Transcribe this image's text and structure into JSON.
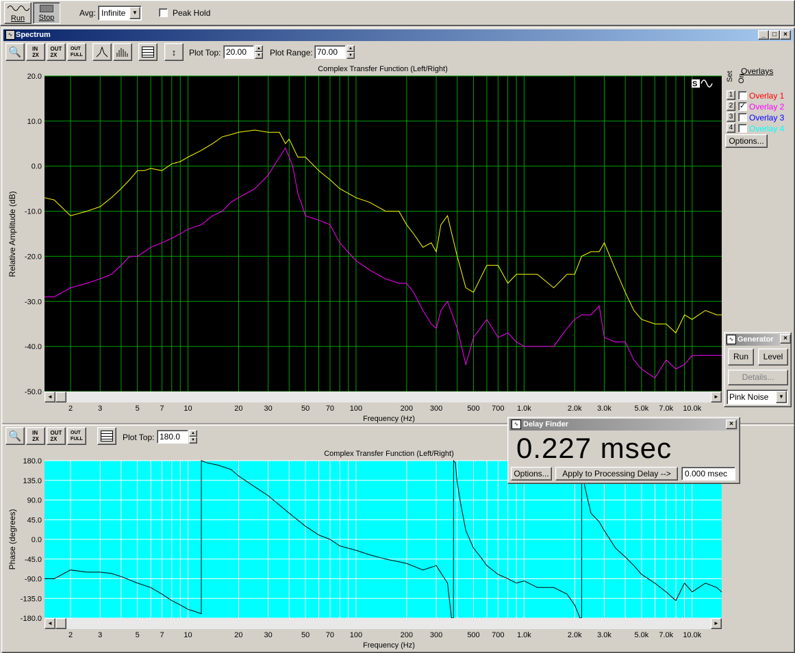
{
  "toolbar": {
    "run_label": "Run",
    "stop_label": "Stop",
    "avg_label": "Avg:",
    "avg_value": "Infinite",
    "peak_hold_label": "Peak Hold"
  },
  "spectrum_window": {
    "title": "Spectrum",
    "plot_top_label": "Plot Top:",
    "plot_top_value": "20.00",
    "plot_range_label": "Plot Range:",
    "plot_range_value": "70.00"
  },
  "phase_toolbar": {
    "plot_top_label": "Plot Top:",
    "plot_top_value": "180.0"
  },
  "overlays": {
    "header": "Overlays",
    "set_label": "Set",
    "on_label": "On",
    "items": [
      {
        "num": "1",
        "label": "Overlay 1",
        "color": "#ff0000",
        "checked": false
      },
      {
        "num": "2",
        "label": "Overlay 2",
        "color": "#ff00ff",
        "checked": true
      },
      {
        "num": "3",
        "label": "Overlay 3",
        "color": "#0000ff",
        "checked": false
      },
      {
        "num": "4",
        "label": "Overlay 4",
        "color": "#00ffff",
        "checked": false
      }
    ],
    "options_label": "Options..."
  },
  "generator": {
    "title": "Generator",
    "run_label": "Run",
    "level_label": "Level",
    "details_label": "Details...",
    "signal_value": "Pink Noise"
  },
  "delay_finder": {
    "title": "Delay Finder",
    "readout": "0.227 msec",
    "options_label": "Options...",
    "apply_label": "Apply to Processing Delay -->",
    "delay_value": "0.000 msec"
  },
  "chart_data": [
    {
      "type": "line",
      "title": "Complex Transfer Function (Left/Right)",
      "xlabel": "Frequency (Hz)",
      "ylabel": "Relative Amplitude (dB)",
      "x_scale": "log",
      "xlim": [
        1.4,
        15000
      ],
      "ylim": [
        -50,
        20
      ],
      "y_ticks": [
        "20.0",
        "10.0",
        "0.0",
        "-10.0",
        "-20.0",
        "-30.0",
        "-40.0",
        "-50.0"
      ],
      "x_ticks": [
        {
          "v": 2,
          "t": "2"
        },
        {
          "v": 3,
          "t": "3"
        },
        {
          "v": 5,
          "t": "5"
        },
        {
          "v": 7,
          "t": "7"
        },
        {
          "v": 10,
          "t": "10"
        },
        {
          "v": 20,
          "t": "20"
        },
        {
          "v": 30,
          "t": "30"
        },
        {
          "v": 50,
          "t": "50"
        },
        {
          "v": 70,
          "t": "70"
        },
        {
          "v": 100,
          "t": "100"
        },
        {
          "v": 200,
          "t": "200"
        },
        {
          "v": 300,
          "t": "300"
        },
        {
          "v": 500,
          "t": "500"
        },
        {
          "v": 700,
          "t": "700"
        },
        {
          "v": 1000,
          "t": "1.0k"
        },
        {
          "v": 2000,
          "t": "2.0k"
        },
        {
          "v": 3000,
          "t": "3.0k"
        },
        {
          "v": 5000,
          "t": "5.0k"
        },
        {
          "v": 7000,
          "t": "7.0k"
        },
        {
          "v": 10000,
          "t": "10.0k"
        }
      ],
      "background": "#000000",
      "grid": true,
      "grid_color": "#00a000",
      "series": [
        {
          "color": "#ffff00",
          "x": [
            1.4,
            1.6,
            2,
            2.5,
            3,
            3.5,
            4,
            4.5,
            5,
            5.5,
            6,
            7,
            8,
            9,
            10,
            12,
            14,
            16,
            18,
            20,
            25,
            30,
            35,
            38,
            40,
            45,
            50,
            60,
            70,
            80,
            100,
            120,
            150,
            180,
            200,
            220,
            250,
            280,
            300,
            320,
            350,
            400,
            450,
            500,
            600,
            700,
            800,
            900,
            1000,
            1200,
            1500,
            1800,
            2000,
            2200,
            2500,
            2800,
            3000,
            3500,
            4000,
            4500,
            5000,
            6000,
            7000,
            8000,
            9000,
            10000,
            12000,
            14000,
            15000
          ],
          "y": [
            -7,
            -7.5,
            -11,
            -10,
            -9,
            -7,
            -5,
            -3,
            -1,
            -1,
            -0.5,
            -1,
            0.5,
            1,
            2,
            3.5,
            5,
            6.5,
            7,
            7.5,
            8,
            7.5,
            7.5,
            5,
            6,
            2,
            2,
            -1,
            -3,
            -5,
            -7,
            -8,
            -10,
            -10,
            -13,
            -15,
            -18,
            -17,
            -19,
            -13,
            -11,
            -20,
            -27,
            -28,
            -22,
            -22,
            -26,
            -24,
            -24,
            -24,
            -27,
            -24,
            -24,
            -20,
            -19,
            -19,
            -17,
            -23,
            -28,
            -32,
            -34,
            -35,
            -35,
            -37,
            -33,
            -34,
            -32,
            -33,
            -33
          ]
        },
        {
          "color": "#ff00ff",
          "x": [
            1.4,
            1.6,
            2,
            2.5,
            3,
            3.5,
            4,
            4.5,
            5,
            5.5,
            6,
            7,
            8,
            9,
            10,
            12,
            14,
            16,
            18,
            20,
            25,
            30,
            35,
            38,
            40,
            42,
            45,
            50,
            60,
            70,
            80,
            100,
            120,
            150,
            180,
            200,
            220,
            250,
            280,
            300,
            320,
            350,
            400,
            450,
            500,
            600,
            700,
            800,
            900,
            1000,
            1200,
            1500,
            1800,
            2000,
            2200,
            2500,
            2800,
            3000,
            3500,
            4000,
            4500,
            5000,
            6000,
            7000,
            8000,
            9000,
            10000,
            12000,
            14000,
            15000
          ],
          "y": [
            -29,
            -29,
            -27,
            -26,
            -25,
            -24,
            -22,
            -20,
            -20,
            -19,
            -18,
            -17,
            -16,
            -15,
            -14,
            -13,
            -11,
            -10,
            -8,
            -7,
            -5,
            -2,
            2,
            4,
            2,
            0,
            -6,
            -11,
            -12,
            -13,
            -17,
            -21,
            -23,
            -25,
            -26,
            -26,
            -28,
            -32,
            -35,
            -36,
            -32,
            -30,
            -36,
            -44,
            -38,
            -34,
            -38,
            -37,
            -39,
            -40,
            -40,
            -40,
            -36,
            -34,
            -33,
            -33,
            -31,
            -38,
            -39,
            -39,
            -43,
            -45,
            -47,
            -43,
            -45,
            -44,
            -42,
            -42,
            -42,
            -42
          ]
        }
      ]
    },
    {
      "type": "line",
      "title": "Complex Transfer Function (Left/Right)",
      "xlabel": "Frequency (Hz)",
      "ylabel": "Phase (degrees)",
      "x_scale": "log",
      "xlim": [
        1.4,
        15000
      ],
      "ylim": [
        -180,
        180
      ],
      "y_ticks": [
        "180.0",
        "135.0",
        "90.0",
        "45.0",
        "0.0",
        "-45.0",
        "-90.0",
        "-135.0",
        "-180.0"
      ],
      "background": "#00ffff",
      "grid": true,
      "grid_color": "#ffffff",
      "series": [
        {
          "color": "#000000",
          "x": [
            1.4,
            1.6,
            2,
            2.5,
            3,
            3.5,
            4,
            5,
            6,
            7,
            8,
            9,
            10,
            11,
            12,
            12.01,
            13,
            15,
            18,
            20,
            25,
            30,
            40,
            50,
            60,
            70,
            80,
            100,
            120,
            150,
            200,
            250,
            300,
            350,
            370,
            380,
            380.5,
            390,
            400,
            420,
            450,
            500,
            550,
            600,
            700,
            800,
            900,
            1000,
            1200,
            1500,
            1800,
            2000,
            2100,
            2150,
            2200,
            2200.5,
            2300,
            2500,
            2800,
            3000,
            3500,
            4000,
            4500,
            5000,
            6000,
            7000,
            8000,
            9000,
            10000,
            12000,
            14000,
            15000
          ],
          "y": [
            -90,
            -90,
            -70,
            -75,
            -75,
            -78,
            -85,
            -100,
            -110,
            -125,
            -140,
            -150,
            -160,
            -165,
            -170,
            180,
            175,
            170,
            160,
            145,
            120,
            100,
            60,
            30,
            10,
            0,
            -15,
            -25,
            -35,
            -45,
            -55,
            -70,
            -60,
            -100,
            -180,
            -180,
            180,
            175,
            130,
            80,
            20,
            -20,
            -40,
            -60,
            -80,
            -90,
            -100,
            -95,
            -110,
            -110,
            -125,
            -150,
            -170,
            -180,
            -180,
            180,
            120,
            60,
            40,
            20,
            -20,
            -40,
            -60,
            -80,
            -100,
            -120,
            -140,
            -100,
            -120,
            -100,
            -110,
            -120
          ]
        }
      ]
    }
  ]
}
